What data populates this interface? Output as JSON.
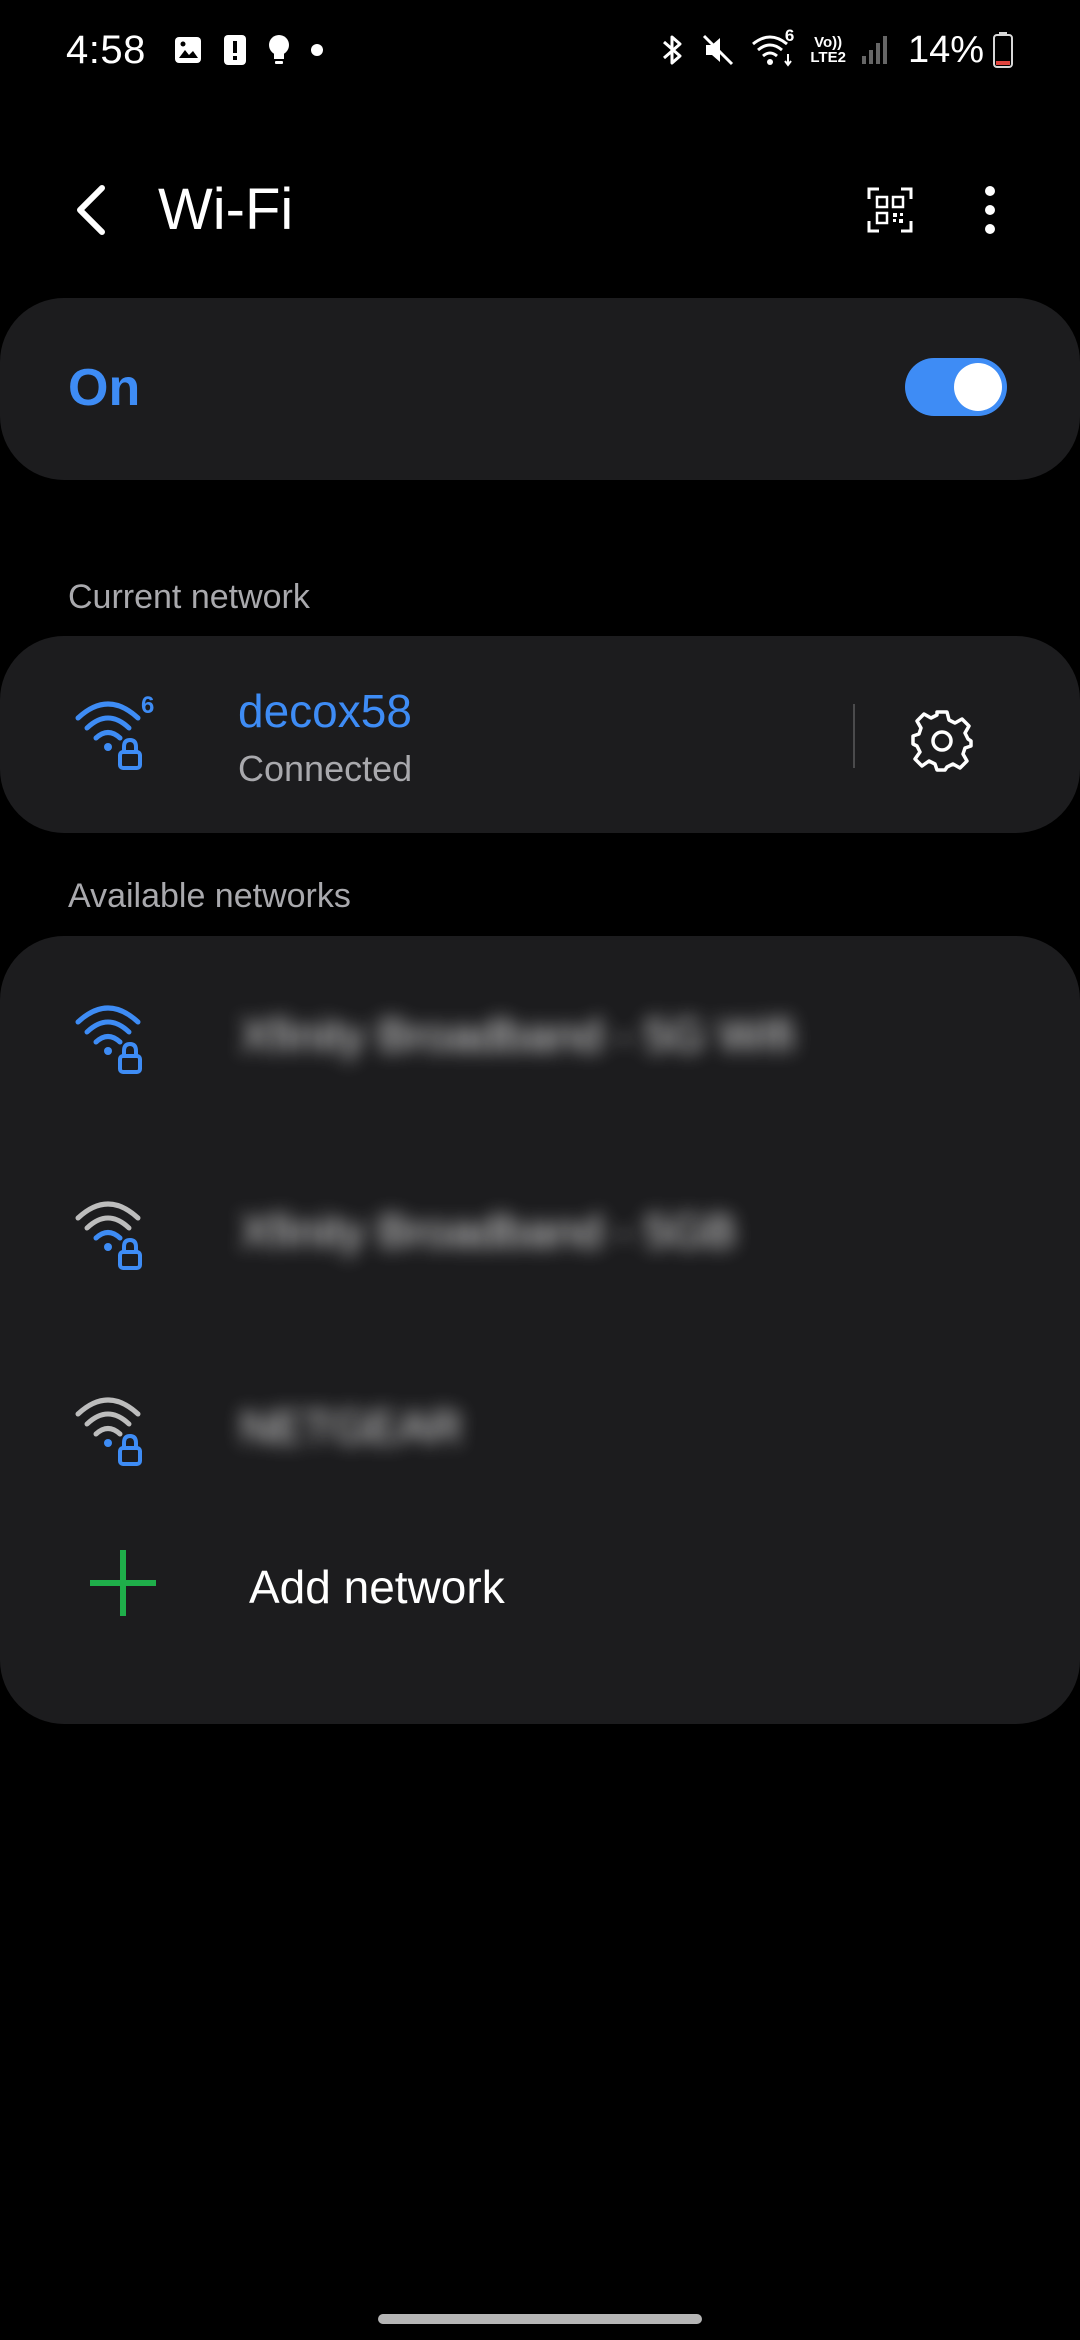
{
  "status_bar": {
    "time": "4:58",
    "lte_line1": "Vo))",
    "lte_line2": "LTE2",
    "wifi_badge": "6",
    "battery_percent": "14%",
    "battery_level": 0.14,
    "icons": [
      "image-icon",
      "alert-icon",
      "bulb-icon",
      "dot-icon",
      "bluetooth-icon",
      "mute-icon",
      "wifi-icon",
      "signal-icon",
      "battery-icon"
    ]
  },
  "header": {
    "title": "Wi-Fi",
    "icons": [
      "back-arrow-icon",
      "qr-code-icon",
      "more-vert-icon"
    ]
  },
  "wifi_toggle": {
    "label": "On",
    "state": true
  },
  "current_section": {
    "label": "Current network",
    "network": {
      "name": "decox58",
      "status": "Connected",
      "badge": "6",
      "icon": "wifi-lock-icon",
      "action_icon": "gear-icon"
    }
  },
  "available_section": {
    "label": "Available networks",
    "networks": [
      {
        "name": "Xfinity Broadband - 5G Wifi",
        "blurred": true,
        "signal_color": "#3e8cf5"
      },
      {
        "name": "Xfinity Broadband - 5GB",
        "blurred": true,
        "signal_color": "#bdbdbd"
      },
      {
        "name": "NETGEAR",
        "blurred": true,
        "signal_color": "#bdbdbd"
      }
    ],
    "add_network": {
      "label": "Add network",
      "icon": "plus-icon"
    }
  },
  "colors": {
    "accent": "#3e8cf5",
    "card": "#1c1c1e",
    "secondary_text": "#a9a9ad",
    "add_green": "#1fae4a",
    "battery_low": "#e0443e"
  }
}
